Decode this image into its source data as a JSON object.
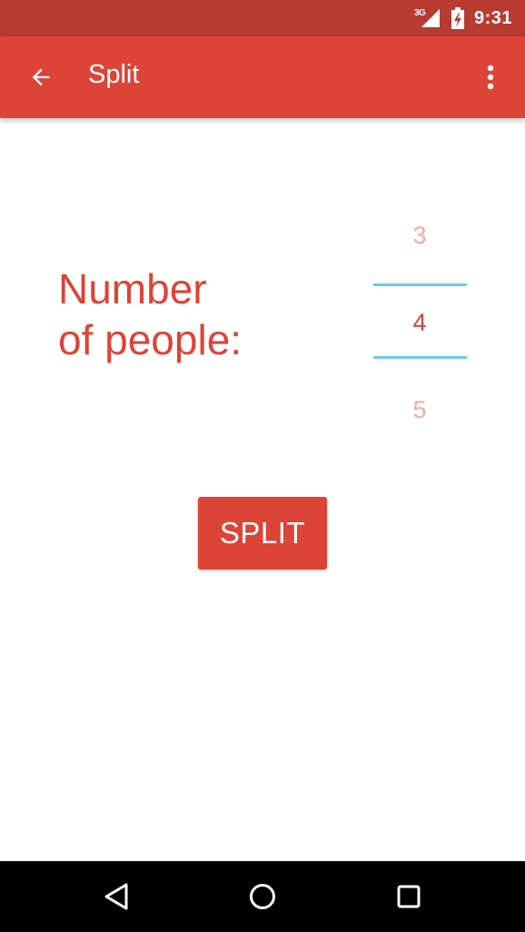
{
  "status_bar": {
    "network": "3G",
    "time": "9:31",
    "icons": [
      "signal-icon",
      "battery-charging-icon"
    ]
  },
  "app_bar": {
    "title": "Split",
    "icons": [
      "arrow-back-icon",
      "more-vert-icon"
    ]
  },
  "content": {
    "label_line1": "Number",
    "label_line2": "of people:",
    "picker": {
      "prev": "3",
      "current": "4",
      "next": "5"
    },
    "split_label": "SPLIT"
  },
  "nav_bar": {
    "icons": [
      "nav-back-icon",
      "nav-home-icon",
      "nav-recents-icon"
    ]
  },
  "colors": {
    "status_bar": "#b83b31",
    "app_bar": "#db4437",
    "accent": "#db4437",
    "picker_faded": "#f0a9a3",
    "picker_divider": "#6fc8ee",
    "nav_bar": "#000000"
  }
}
